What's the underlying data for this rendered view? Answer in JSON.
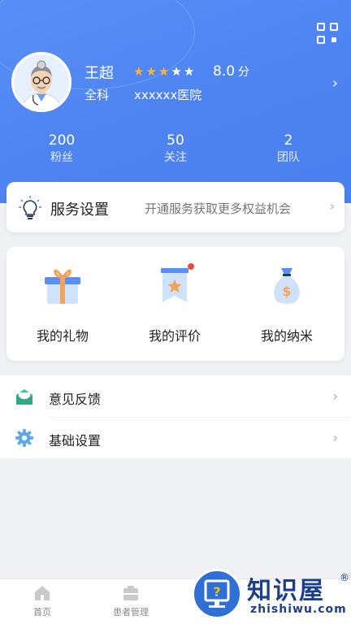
{
  "profile": {
    "name": "王超",
    "department": "全科",
    "hospital": "xxxxxx医院",
    "rating_stars": 3,
    "rating_max": 5,
    "score": "8.0",
    "score_unit": "分"
  },
  "stats": [
    {
      "value": "200",
      "label": "粉丝"
    },
    {
      "value": "50",
      "label": "关注"
    },
    {
      "value": "2",
      "label": "团队"
    }
  ],
  "service": {
    "title": "服务设置",
    "description": "开通服务获取更多权益机会"
  },
  "grid": [
    {
      "label": "我的礼物",
      "icon": "gift-icon"
    },
    {
      "label": "我的评价",
      "icon": "evaluation-badge-icon"
    },
    {
      "label": "我的纳米",
      "icon": "money-bag-icon"
    }
  ],
  "list": [
    {
      "label": "意见反馈",
      "icon": "feedback-envelope-icon"
    },
    {
      "label": "基础设置",
      "icon": "gear-icon"
    }
  ],
  "tabbar": [
    {
      "label": "首页",
      "icon": "home-icon"
    },
    {
      "label": "患者管理",
      "icon": "patient-folder-icon"
    }
  ],
  "watermark": {
    "cn": "知识屋",
    "en": "zhishiwu.com",
    "registered": "®"
  },
  "colors": {
    "header_blue": "#4f85f2",
    "star_gold": "#f5b53f",
    "badge_red": "#e94b3c"
  }
}
